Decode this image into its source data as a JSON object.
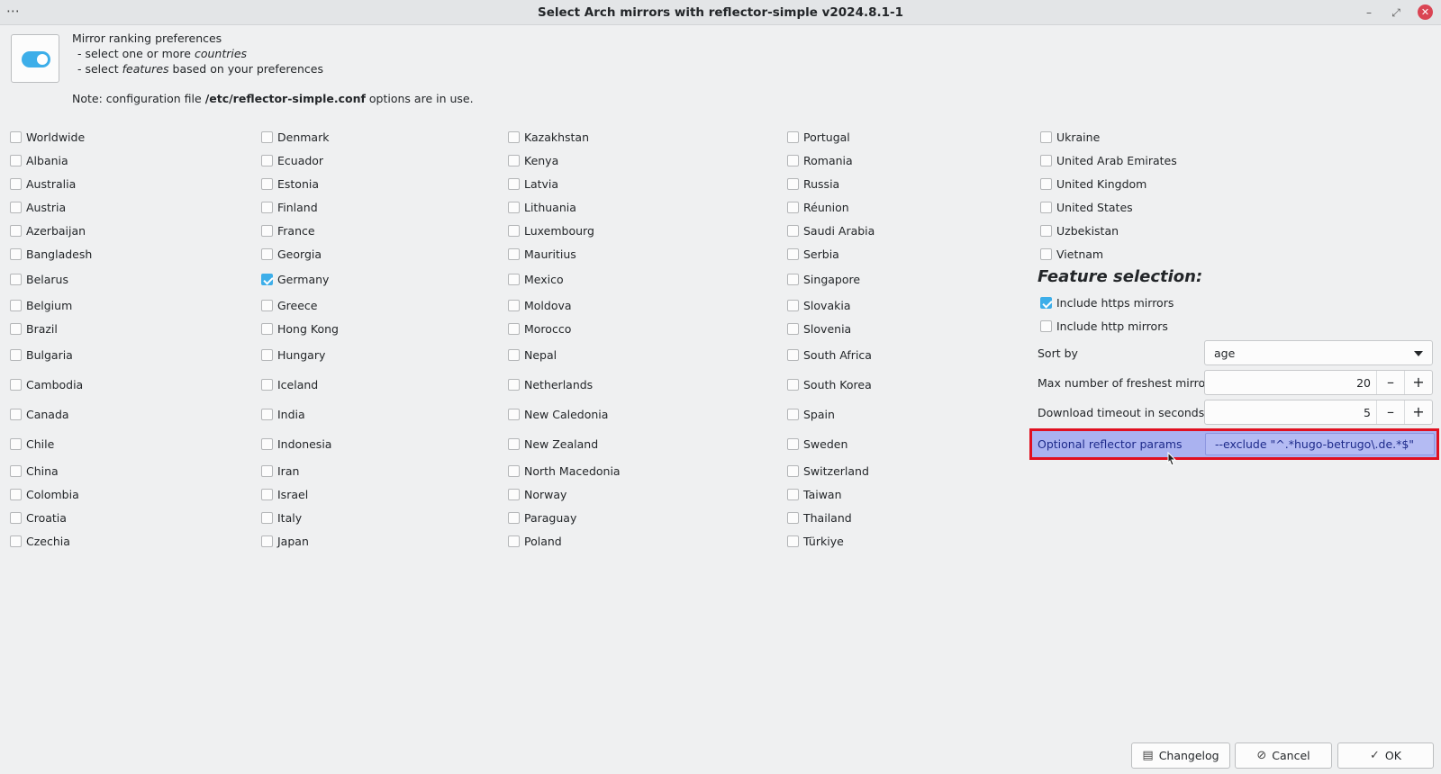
{
  "window": {
    "title": "Select Arch mirrors with reflector-simple v2024.8.1-1",
    "menu_glyph": "⋯",
    "min_glyph": "–",
    "max_glyph": "⤢",
    "close_glyph": "✕"
  },
  "header": {
    "line1": "Mirror ranking preferences",
    "line2_prefix": "- select one or more ",
    "line2_em": "countries",
    "line3_prefix": "- select ",
    "line3_em": "features",
    "line3_suffix": " based on your preferences",
    "note_prefix": "Note: configuration file ",
    "note_file": "/etc/reflector-simple.conf",
    "note_suffix": " options are in use."
  },
  "countries": {
    "col1": [
      {
        "label": "Worldwide",
        "checked": false
      },
      {
        "label": "Albania",
        "checked": false
      },
      {
        "label": "Australia",
        "checked": false
      },
      {
        "label": "Austria",
        "checked": false
      },
      {
        "label": "Azerbaijan",
        "checked": false
      },
      {
        "label": "Bangladesh",
        "checked": false
      },
      {
        "label": "Belarus",
        "checked": false
      },
      {
        "label": "Belgium",
        "checked": false
      },
      {
        "label": "Brazil",
        "checked": false
      },
      {
        "label": "Bulgaria",
        "checked": false
      },
      {
        "label": "Cambodia",
        "checked": false
      },
      {
        "label": "Canada",
        "checked": false
      },
      {
        "label": "Chile",
        "checked": false
      },
      {
        "label": "China",
        "checked": false
      },
      {
        "label": "Colombia",
        "checked": false
      },
      {
        "label": "Croatia",
        "checked": false
      },
      {
        "label": "Czechia",
        "checked": false
      }
    ],
    "col2": [
      {
        "label": "Denmark",
        "checked": false
      },
      {
        "label": "Ecuador",
        "checked": false
      },
      {
        "label": "Estonia",
        "checked": false
      },
      {
        "label": "Finland",
        "checked": false
      },
      {
        "label": "France",
        "checked": false
      },
      {
        "label": "Georgia",
        "checked": false
      },
      {
        "label": "Germany",
        "checked": true
      },
      {
        "label": "Greece",
        "checked": false
      },
      {
        "label": "Hong Kong",
        "checked": false
      },
      {
        "label": "Hungary",
        "checked": false
      },
      {
        "label": "Iceland",
        "checked": false
      },
      {
        "label": "India",
        "checked": false
      },
      {
        "label": "Indonesia",
        "checked": false
      },
      {
        "label": "Iran",
        "checked": false
      },
      {
        "label": "Israel",
        "checked": false
      },
      {
        "label": "Italy",
        "checked": false
      },
      {
        "label": "Japan",
        "checked": false
      }
    ],
    "col3": [
      {
        "label": "Kazakhstan",
        "checked": false
      },
      {
        "label": "Kenya",
        "checked": false
      },
      {
        "label": "Latvia",
        "checked": false
      },
      {
        "label": "Lithuania",
        "checked": false
      },
      {
        "label": "Luxembourg",
        "checked": false
      },
      {
        "label": "Mauritius",
        "checked": false
      },
      {
        "label": "Mexico",
        "checked": false
      },
      {
        "label": "Moldova",
        "checked": false
      },
      {
        "label": "Morocco",
        "checked": false
      },
      {
        "label": "Nepal",
        "checked": false
      },
      {
        "label": "Netherlands",
        "checked": false
      },
      {
        "label": "New Caledonia",
        "checked": false
      },
      {
        "label": "New Zealand",
        "checked": false
      },
      {
        "label": "North Macedonia",
        "checked": false
      },
      {
        "label": "Norway",
        "checked": false
      },
      {
        "label": "Paraguay",
        "checked": false
      },
      {
        "label": "Poland",
        "checked": false
      }
    ],
    "col4": [
      {
        "label": "Portugal",
        "checked": false
      },
      {
        "label": "Romania",
        "checked": false
      },
      {
        "label": "Russia",
        "checked": false
      },
      {
        "label": "Réunion",
        "checked": false
      },
      {
        "label": "Saudi Arabia",
        "checked": false
      },
      {
        "label": "Serbia",
        "checked": false
      },
      {
        "label": "Singapore",
        "checked": false
      },
      {
        "label": "Slovakia",
        "checked": false
      },
      {
        "label": "Slovenia",
        "checked": false
      },
      {
        "label": "South Africa",
        "checked": false
      },
      {
        "label": "South Korea",
        "checked": false
      },
      {
        "label": "Spain",
        "checked": false
      },
      {
        "label": "Sweden",
        "checked": false
      },
      {
        "label": "Switzerland",
        "checked": false
      },
      {
        "label": "Taiwan",
        "checked": false
      },
      {
        "label": "Thailand",
        "checked": false
      },
      {
        "label": "Türkiye",
        "checked": false
      }
    ],
    "col5": [
      {
        "label": "Ukraine",
        "checked": false
      },
      {
        "label": "United Arab Emirates",
        "checked": false
      },
      {
        "label": "United Kingdom",
        "checked": false
      },
      {
        "label": "United States",
        "checked": false
      },
      {
        "label": "Uzbekistan",
        "checked": false
      },
      {
        "label": "Vietnam",
        "checked": false
      }
    ]
  },
  "features": {
    "title": "Feature selection:",
    "https": {
      "label": "Include https mirrors",
      "checked": true
    },
    "http": {
      "label": "Include http mirrors",
      "checked": false
    },
    "sort_by": {
      "label": "Sort by",
      "value": "age"
    },
    "max_mirrors": {
      "label": "Max number of freshest mirrors",
      "value": "20"
    },
    "timeout": {
      "label": "Download timeout in seconds",
      "value": "5"
    },
    "optional": {
      "label": "Optional reflector params",
      "value": "--exclude \"^.*hugo-betrugo\\.de.*$\""
    },
    "minus_glyph": "–",
    "plus_glyph": "+"
  },
  "buttons": {
    "changelog": "Changelog",
    "cancel": "Cancel",
    "ok": "OK"
  },
  "colors": {
    "accent": "#3daee9",
    "highlight_border": "#e01020",
    "highlight_fill": "#aab2f0"
  }
}
